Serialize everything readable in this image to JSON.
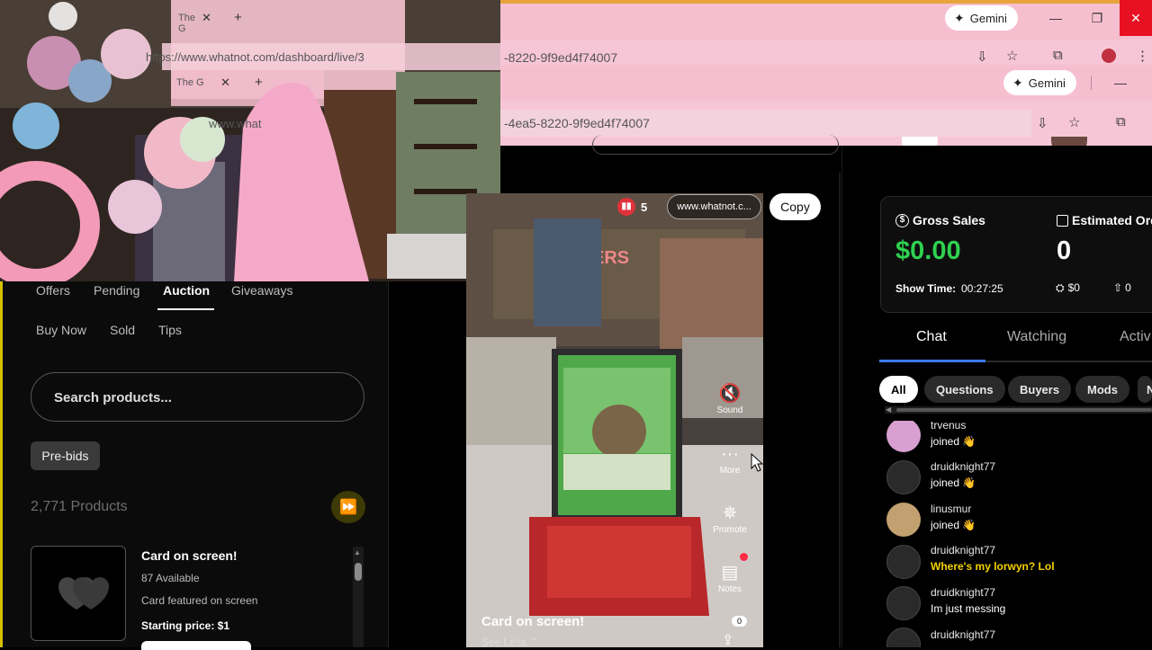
{
  "browser_back": {
    "gemini_label": "Gemini",
    "url_fragment": "-8220-9f9ed4f74007",
    "close_symbol": "✕"
  },
  "browser_front": {
    "gemini_label": "Gemini",
    "url_fragment": "-4ea5-8220-9f9ed4f74007"
  },
  "cam_browser": {
    "tab1_label": "The G",
    "tab2_label": "The G",
    "url": "https://www.whatnot.com/dashboard/live/3",
    "url2": "www.what"
  },
  "left_panel": {
    "tabs_row1": [
      "Offers",
      "Pending",
      "Auction",
      "Giveaways"
    ],
    "tabs_row2": [
      "Buy Now",
      "Sold",
      "Tips"
    ],
    "active_tab": "Auction",
    "search_placeholder": "Search products...",
    "prebids_label": "Pre-bids",
    "product_count": "2,771 Products",
    "product": {
      "title": "Card on screen!",
      "available": "87 Available",
      "description": "Card featured on screen",
      "price": "Starting price: $1"
    }
  },
  "video": {
    "viewer_count": "5",
    "url_pill": "www.whatnot.c...",
    "copy_label": "Copy",
    "title": "Card on screen!",
    "see_less": "See Less",
    "side_buttons": [
      "Sound",
      "More",
      "Promote",
      "Notes"
    ],
    "share_count": "0"
  },
  "stats": {
    "gross_sales_label": "Gross Sales",
    "gross_sales_value": "$0.00",
    "est_orders_label": "Estimated Ord",
    "est_orders_value": "0",
    "show_time_label": "Show Time:",
    "show_time_value": "00:27:25",
    "tips_value": "$0",
    "shares_value": "0"
  },
  "chat": {
    "tabs": [
      "Chat",
      "Watching",
      "Activ"
    ],
    "filters": [
      "All",
      "Questions",
      "Buyers",
      "Mods",
      "N"
    ],
    "messages": [
      {
        "user": "trvenus",
        "text": "joined 👋",
        "highlight": false
      },
      {
        "user": "druidknight77",
        "text": "joined 👋",
        "highlight": false
      },
      {
        "user": "linusmur",
        "text": "joined 👋",
        "highlight": false
      },
      {
        "user": "druidknight77",
        "text": "Where's my lorwyn? Lol",
        "highlight": true
      },
      {
        "user": "druidknight77",
        "text": "Im just messing",
        "highlight": false
      },
      {
        "user": "druidknight77",
        "text": "",
        "highlight": false
      }
    ]
  },
  "colors": {
    "accent_green": "#2fd14f",
    "chat_tab_underline": "#3d7bf0",
    "highlight_yellow": "#f5d100",
    "browser_pink": "#f6bfd0"
  }
}
